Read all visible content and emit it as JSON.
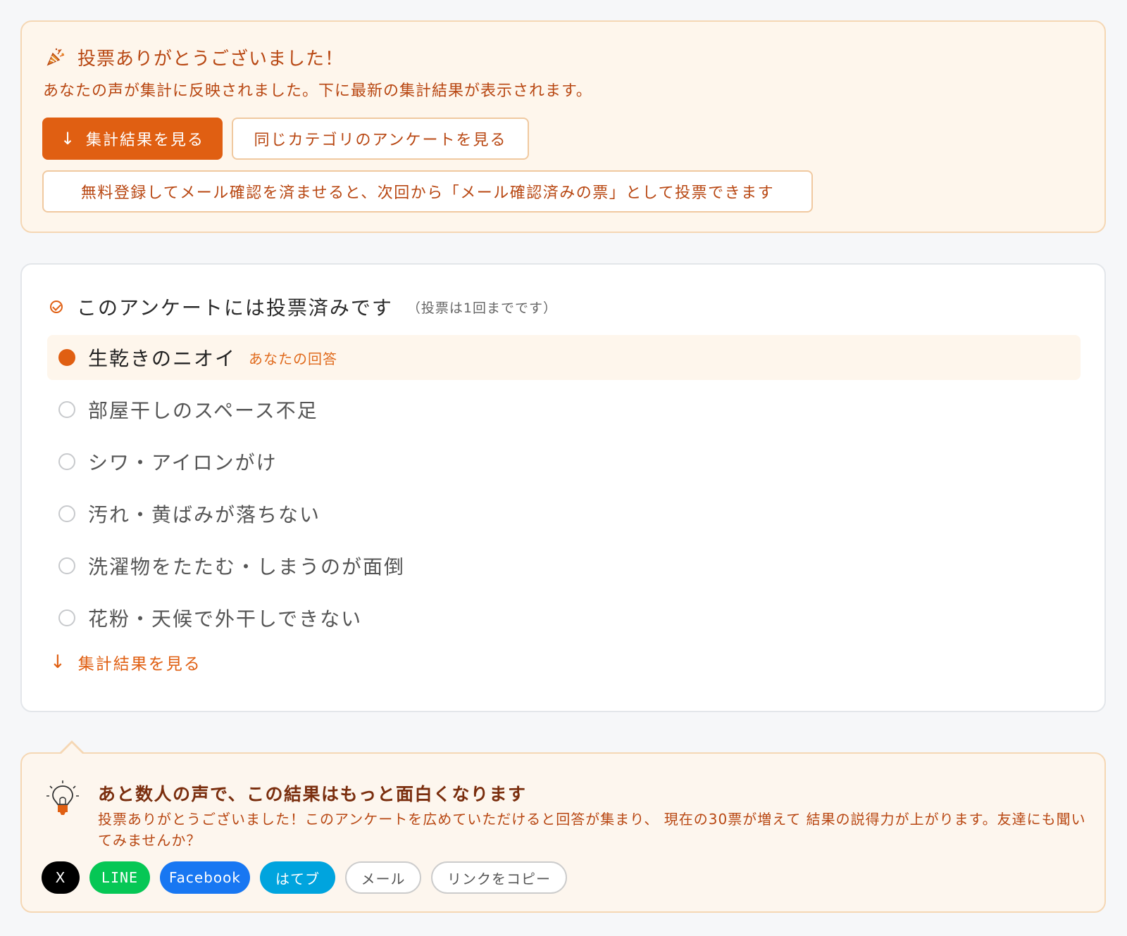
{
  "thanks": {
    "title": "投票ありがとうございました！",
    "message": "あなたの声が集計に反映されました。下に最新の集計結果が表示されます。",
    "view_results_label": "集計結果を見る",
    "same_category_label": "同じカテゴリのアンケートを見る",
    "register_label": "無料登録してメール確認を済ませると、次回から「メール確認済みの票」として投票できます",
    "icons": {
      "title": "party-popper-icon",
      "view_results": "arrow-down-icon"
    }
  },
  "poll": {
    "voted_text": "このアンケートには投票済みです",
    "voted_note": "（投票は1回までです）",
    "your_answer_label": "あなたの回答",
    "options": [
      {
        "label": "生乾きのニオイ",
        "selected": true
      },
      {
        "label": "部屋干しのスペース不足",
        "selected": false
      },
      {
        "label": "シワ・アイロンがけ",
        "selected": false
      },
      {
        "label": "汚れ・黄ばみが落ちない",
        "selected": false
      },
      {
        "label": "洗濯物をたたむ・しまうのが面倒",
        "selected": false
      },
      {
        "label": "花粉・天候で外干しできない",
        "selected": false
      }
    ],
    "results_link_label": "集計結果を見る",
    "icons": {
      "voted": "check-circle-icon",
      "results_link": "arrow-down-icon"
    }
  },
  "share": {
    "title": "あと数人の声で、この結果はもっと面白くなります",
    "body": "投票ありがとうございました！このアンケートを広めていただけると回答が集まり、 現在の30票が増えて 結果の説得力が上がります。友達にも聞いてみませんか？",
    "buttons": {
      "x": "X",
      "line": "LINE",
      "facebook": "Facebook",
      "hatena": "はてブ",
      "mail": "メール",
      "copy": "リンクをコピー"
    },
    "icons": {
      "hint": "lightbulb-icon"
    }
  },
  "colors": {
    "accent": "#e05f12",
    "accent_text": "#b84712",
    "card_warm_bg": "#fef6ec",
    "x": "#000000",
    "line": "#06c755",
    "facebook": "#1877f2",
    "hatena": "#00a4de"
  }
}
